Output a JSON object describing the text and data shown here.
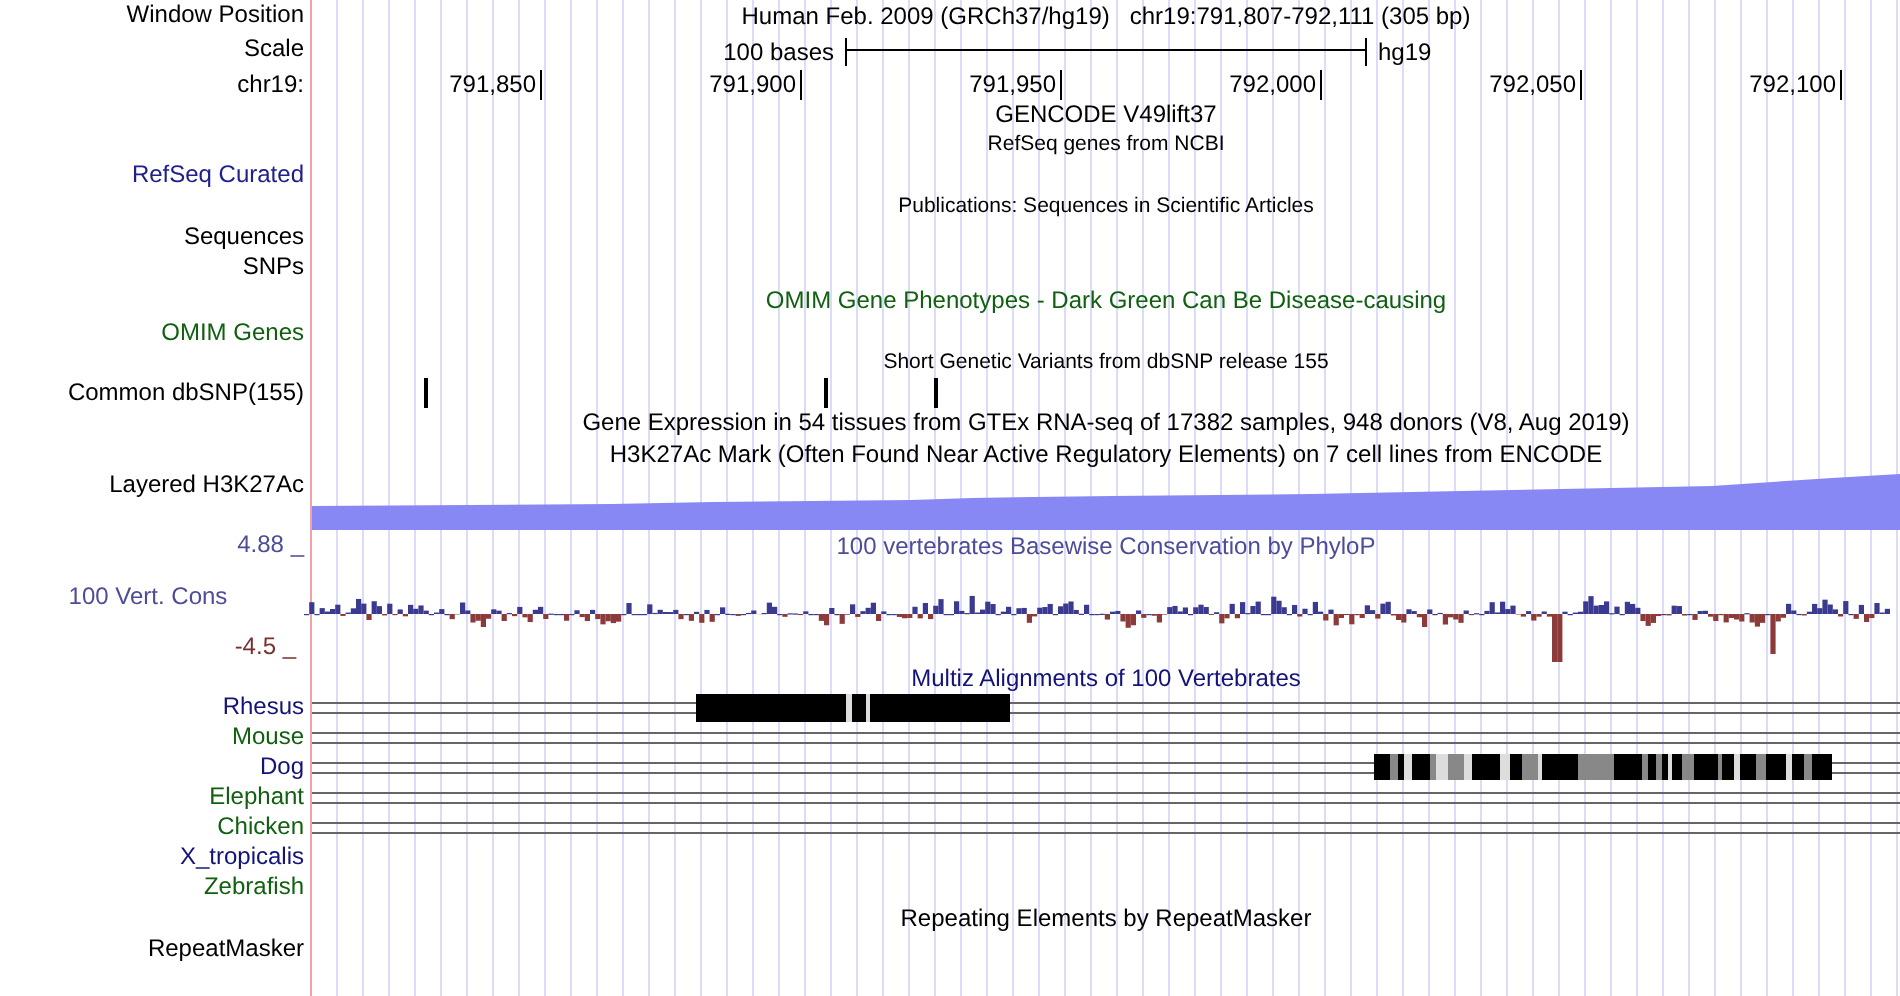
{
  "ruler": {
    "window_label": "Window Position",
    "assembly": "Human Feb. 2009 (GRCh37/hg19)",
    "position": "chr19:791,807-792,111 (305 bp)",
    "scale_label": "Scale",
    "scale_text": "100 bases",
    "scale_db": "hg19",
    "chrom_label": "chr19:",
    "ticks": [
      "791,850",
      "791,900",
      "791,950",
      "792,000",
      "792,050",
      "792,100"
    ]
  },
  "tracks": [
    {
      "kind": "empty",
      "title": {
        "text": "GENCODE V49lift37",
        "color": "#000000"
      }
    },
    {
      "kind": "genes",
      "title": {
        "text": "RefSeq genes from NCBI",
        "color": "#000000",
        "small": true
      },
      "labels": [
        "RefSeq Curated"
      ],
      "color": "#20208c"
    },
    {
      "kind": "pubs",
      "title": {
        "text": "Publications: Sequences in Scientific Articles",
        "color": "#000000",
        "small": true
      },
      "labels": [
        "Sequences",
        "SNPs"
      ],
      "color": "#000000"
    },
    {
      "kind": "omim",
      "title": {
        "text": "OMIM Gene Phenotypes - Dark Green Can Be Disease-causing",
        "color": "#106010"
      },
      "labels": [
        "OMIM Genes"
      ],
      "color": "#106010"
    },
    {
      "kind": "snps",
      "title": {
        "text": "Short Genetic Variants from dbSNP release 155",
        "color": "#000000",
        "small": true
      },
      "labels": [
        "Common dbSNP(155)"
      ],
      "color": "#000000"
    },
    {
      "kind": "empty",
      "title": {
        "text": "Gene Expression in 54 tissues from GTEx RNA-seq of 17382 samples, 948 donors (V8, Aug 2019)",
        "color": "#000000"
      }
    },
    {
      "kind": "area",
      "title": {
        "text": "H3K27Ac Mark (Often Found Near Active Regulatory Elements) on 7 cell lines from ENCODE",
        "color": "#000000"
      },
      "labels": [
        "Layered H3K27Ac"
      ],
      "color": "#000000"
    },
    {
      "kind": "wiggle",
      "title": {
        "text": "100 vertebrates Basewise Conservation by PhyloP",
        "color": "#4c4c98"
      },
      "labels": [
        "100 Vert. Cons"
      ],
      "color": "#4c4c98",
      "max": "4.88 _",
      "min": "-4.5 _"
    },
    {
      "kind": "multiz",
      "title": {
        "text": "Multiz Alignments of 100 Vertebrates",
        "color": "#141478"
      },
      "species": [
        {
          "name": "Rhesus",
          "color": "#141478",
          "kind": "lines"
        },
        {
          "name": "Mouse",
          "color": "#106010",
          "kind": "lines"
        },
        {
          "name": "Dog",
          "color": "#141478",
          "kind": "lines"
        },
        {
          "name": "Elephant",
          "color": "#106010",
          "kind": "lines"
        },
        {
          "name": "Chicken",
          "color": "#106010",
          "kind": "lines"
        },
        {
          "name": "X_tropicalis",
          "color": "#141478",
          "kind": "blank"
        },
        {
          "name": "Zebrafish",
          "color": "#106010",
          "kind": "blank"
        }
      ]
    },
    {
      "kind": "repeats",
      "title": {
        "text": "Repeating Elements by RepeatMasker",
        "color": "#000000"
      },
      "labels": [
        "RepeatMasker"
      ],
      "color": "#000000"
    }
  ]
}
